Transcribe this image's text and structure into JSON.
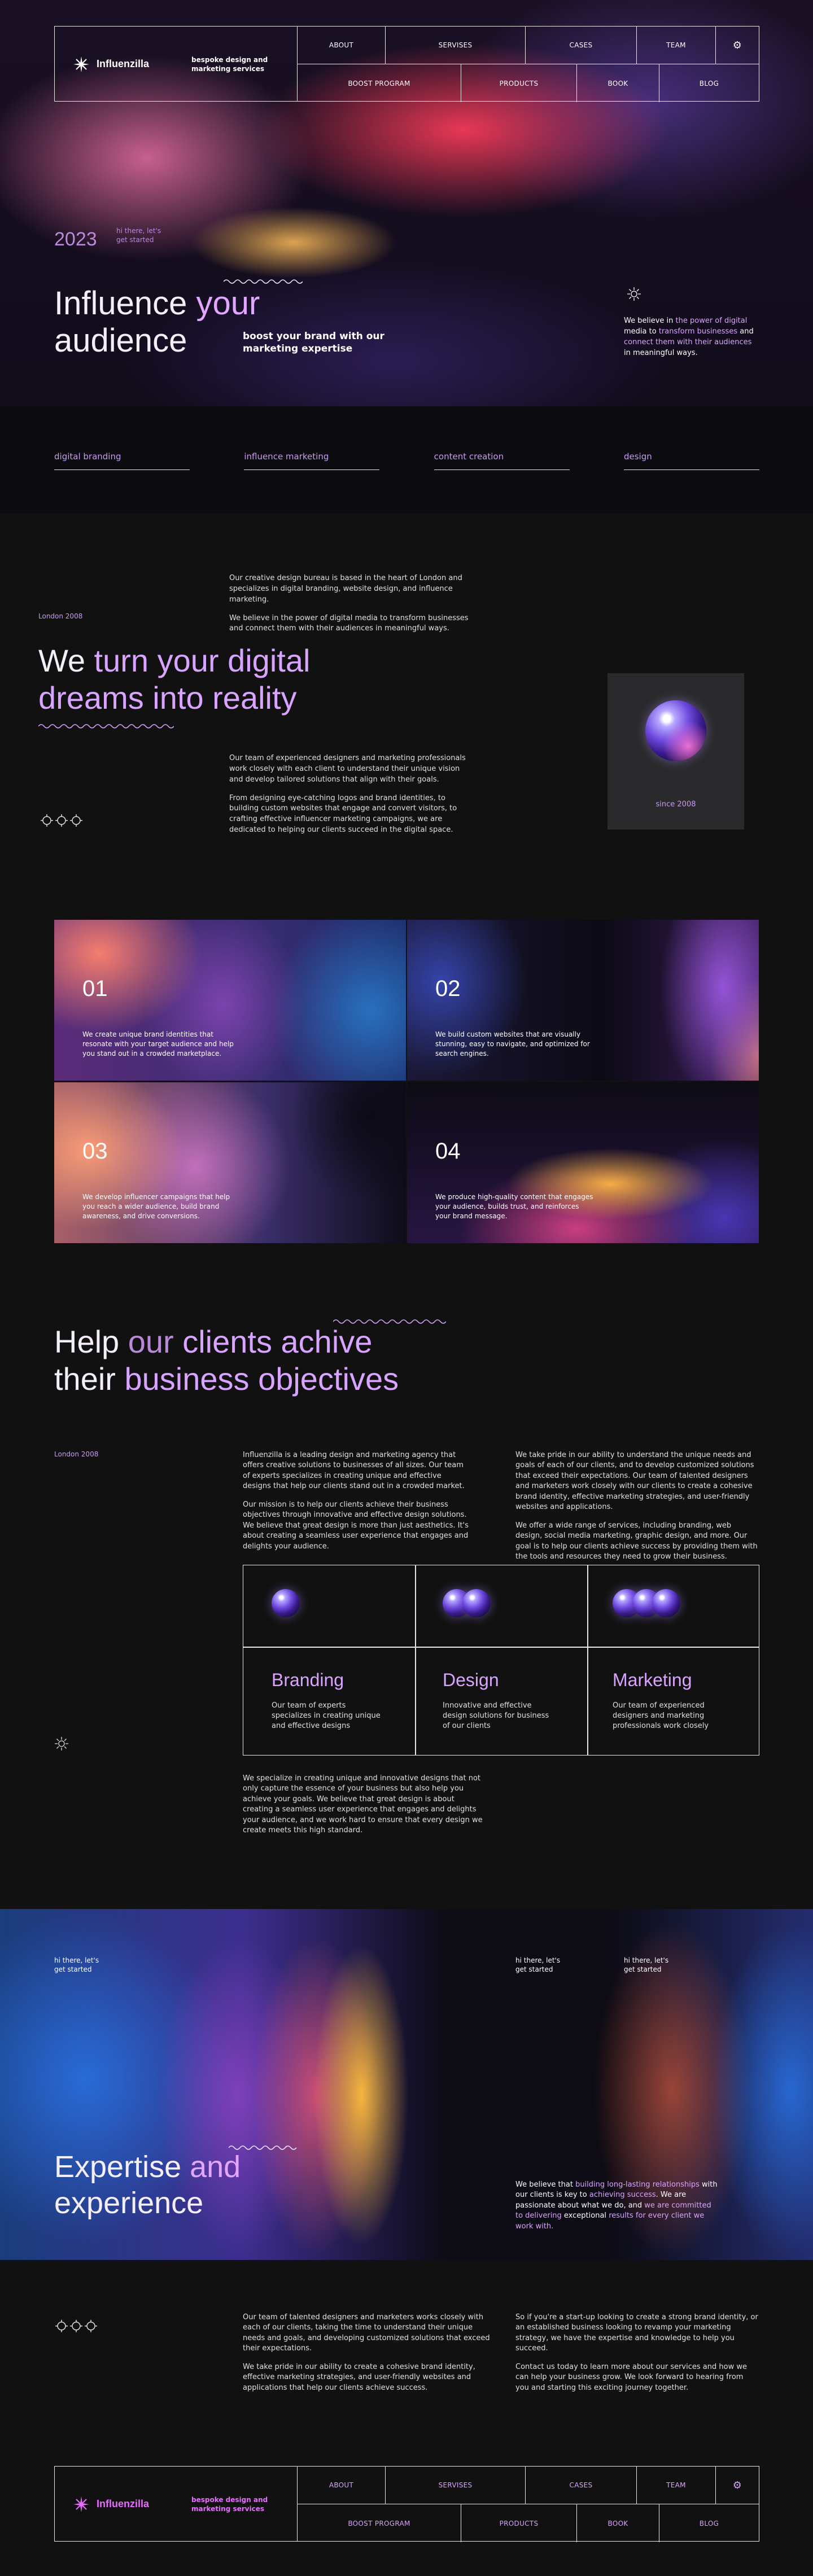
{
  "nav": {
    "brand": "Influenzilla",
    "tagline": "bespoke design and marketing services",
    "row1": [
      "ABOUT",
      "SERVISES",
      "CASES",
      "TEAM"
    ],
    "row2": [
      "BOOST PROGRAM",
      "PRODUCTS",
      "BOOK",
      "BLOG"
    ]
  },
  "hero": {
    "year": "2023",
    "hi_line1": "hi there, let's",
    "hi_line2": "get started",
    "title_a": "Influence ",
    "title_b": "your",
    "title_c": "audience",
    "boost": "boost your brand with our marketing expertise",
    "believe_1": "We believe in ",
    "believe_2": "the power of digital",
    "believe_3": " media to ",
    "believe_4": "transform businesses",
    "believe_5": " and ",
    "believe_6": "connect them with their audiences",
    "believe_7": " in meaningful ways.",
    "categories": [
      "digital branding",
      "influence marketing",
      "content creation",
      "design"
    ]
  },
  "about": {
    "intro_1": "Our creative design bureau is based in the heart of London and specializes in digital branding, website design, and influence marketing.",
    "intro_2": "We believe in the power of digital media to transform businesses and connect them with their audiences in meaningful ways.",
    "location": "London 2008",
    "title_a": "We ",
    "title_b": "turn your digital",
    "title_c": "dreams ",
    "title_d": "into reality",
    "body_1": "Our team of experienced designers and marketing professionals work closely with each client to understand their unique vision and develop tailored solutions that align with their goals.",
    "body_2": "From designing eye-catching logos and brand identities, to building custom websites that engage and convert visitors, to crafting effective influencer marketing campaigns, we are dedicated to helping our clients succeed in the digital space.",
    "since": "since 2008"
  },
  "services": [
    {
      "num": "01",
      "text": "We create unique brand identities that resonate with your target audience and help you stand out in a crowded marketplace."
    },
    {
      "num": "02",
      "text": "We build custom websites that are visually stunning, easy to navigate, and optimized for search engines."
    },
    {
      "num": "03",
      "text": "We develop influencer campaigns that help you reach a wider audience, build brand awareness, and drive conversions."
    },
    {
      "num": "04",
      "text": "We produce high-quality content that engages your audience, builds trust, and reinforces your brand message."
    }
  ],
  "help": {
    "title_a": "Help ",
    "title_b": "our ",
    "title_c": "clients achive",
    "title_d": "their ",
    "title_e": "business objectives",
    "location": "London 2008",
    "col1_p1": "Influenzilla is a leading design and marketing agency that offers creative solutions to businesses of all sizes. Our team of experts specializes in creating unique and effective designs that help our clients stand out in a crowded market.",
    "col1_p2": "Our mission is to help our clients achieve their business objectives through innovative and effective design solutions. We believe that great design is more than just aesthetics. It's about creating a seamless user experience that engages and delights your audience.",
    "col2_p1": "We take pride in our ability to understand the unique needs and goals of each of our clients, and to develop customized solutions that exceed their expectations. Our team of talented designers and marketers work closely with our clients to create a cohesive brand identity, effective marketing strategies, and user-friendly websites and applications.",
    "col2_p2": "We offer a wide range of services, including branding, web design, social media marketing, graphic design, and more. Our goal is to help our clients achieve success by providing them with the tools and resources they need to grow their business.",
    "cards": [
      {
        "title": "Branding",
        "text": "Our team of experts specializes in creating unique and effective designs"
      },
      {
        "title": "Design",
        "text": "Innovative and effective design solutions for business of our clients"
      },
      {
        "title": "Marketing",
        "text": "Our team of experienced designers and marketing professionals work closely"
      }
    ],
    "foot": "We specialize in creating unique and innovative designs that not only capture the essence of your business but also help you achieve your goals. We believe that great design is about creating a seamless user experience that engages and delights your audience, and we work hard to ensure that every design we create meets this high standard."
  },
  "expertise": {
    "hi_a1": "hi there, let's",
    "hi_a2": "get started",
    "hi_b1": "hi there, let's",
    "hi_b2": "get started",
    "hi_c1": "hi there, let's",
    "hi_c2": "get started",
    "title_a": "Expertise ",
    "title_b": "and",
    "title_c": "experience",
    "believe_1": "We believe that ",
    "believe_2": "building long-lasting relationships",
    "believe_3": " with our clients is key to ",
    "believe_4": "achieving success",
    "believe_5": ". We are passionate about what we do, and ",
    "believe_6": "we are committed to delivering",
    "believe_7": " exceptional ",
    "believe_8": "results for every client we work with."
  },
  "closing": {
    "col1_p1": "Our team of talented designers and marketers works closely with each of our clients, taking the time to understand their unique needs and goals, and developing customized solutions that exceed their expectations.",
    "col1_p2": "We take pride in our ability to create a cohesive brand identity, effective marketing strategies, and user-friendly websites and applications that help our clients achieve success.",
    "col2_p1": "So if you're a start-up looking to create a strong brand identity, or an established business looking to revamp your marketing strategy, we have the expertise and knowledge to help you succeed.",
    "col2_p2": "Contact us today to learn more about our services and how we can help your business grow. We look forward to hearing from you and starting this exciting journey together."
  }
}
